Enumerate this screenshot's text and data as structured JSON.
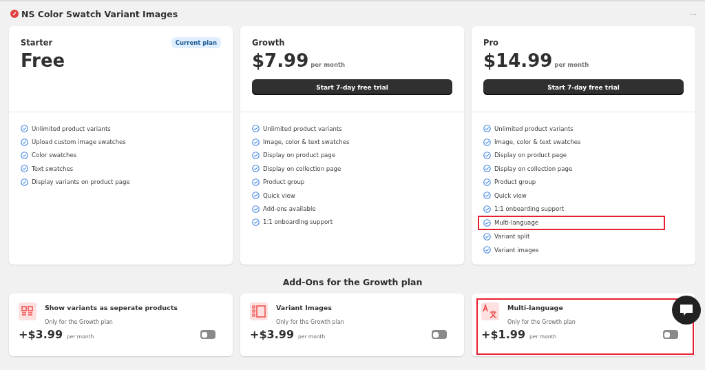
{
  "header": {
    "title": "NS Color Swatch Variant Images",
    "menu": "···"
  },
  "plans": [
    {
      "name": "Starter",
      "badge": "Current plan",
      "price": "Free",
      "features": [
        {
          "text": "Unlimited product variants",
          "highlighted": false
        },
        {
          "text": "Upload custom image swatches",
          "highlighted": false
        },
        {
          "text": "Color swatches",
          "highlighted": false
        },
        {
          "text": "Text swatches",
          "highlighted": false
        },
        {
          "text": "Display variants on product page",
          "highlighted": false
        }
      ]
    },
    {
      "name": "Growth",
      "price": "$7.99",
      "period": "per month",
      "button": "Start 7-day free trial",
      "features": [
        {
          "text": "Unlimited product variants",
          "highlighted": false
        },
        {
          "text": "Image, color & text swatches",
          "highlighted": false
        },
        {
          "text": "Display on product page",
          "highlighted": false
        },
        {
          "text": "Display on collection page",
          "highlighted": false
        },
        {
          "text": "Product group",
          "highlighted": false
        },
        {
          "text": "Quick view",
          "highlighted": false
        },
        {
          "text": "Add-ons available",
          "highlighted": false
        },
        {
          "text": "1:1 onboarding support",
          "highlighted": false
        }
      ]
    },
    {
      "name": "Pro",
      "price": "$14.99",
      "period": "per month",
      "button": "Start 7-day free trial",
      "features": [
        {
          "text": "Unlimited product variants",
          "highlighted": false
        },
        {
          "text": "Image, color & text swatches",
          "highlighted": false
        },
        {
          "text": "Display on product page",
          "highlighted": false
        },
        {
          "text": "Display on collection page",
          "highlighted": false
        },
        {
          "text": "Product group",
          "highlighted": false
        },
        {
          "text": "Quick view",
          "highlighted": false
        },
        {
          "text": "1:1 onboarding support",
          "highlighted": false
        },
        {
          "text": "Multi-language",
          "highlighted": true
        },
        {
          "text": "Variant split",
          "highlighted": false
        },
        {
          "text": "Variant images",
          "highlighted": false
        }
      ]
    }
  ],
  "addons_title": "Add-Ons for the Growth plan",
  "addons": [
    {
      "kind": "grid",
      "title": "Show variants as seperate products",
      "note": "Only for the Growth plan",
      "price": "+$3.99",
      "period": "per month",
      "on": false,
      "highlighted": false
    },
    {
      "kind": "gallery",
      "title": "Variant Images",
      "note": "Only for the Growth plan",
      "price": "+$3.99",
      "period": "per month",
      "on": false,
      "highlighted": false
    },
    {
      "kind": "translate",
      "title": "Multi-language",
      "note": "Only for the Growth plan",
      "price": "+$1.99",
      "period": "per month",
      "on": false,
      "highlighted": true
    }
  ]
}
